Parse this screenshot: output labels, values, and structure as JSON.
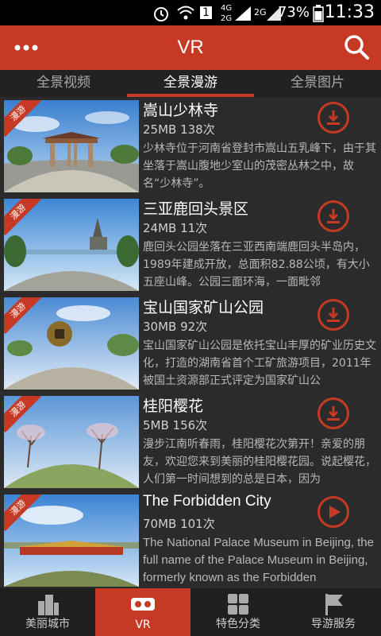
{
  "status_bar": {
    "battery": "73%",
    "time": "11:33"
  },
  "app_bar": {
    "title": "VR"
  },
  "tabs": [
    {
      "label": "全景视频"
    },
    {
      "label": "全景漫游"
    },
    {
      "label": "全景图片"
    }
  ],
  "badge_label": "漫游",
  "items": [
    {
      "title": "嵩山少林寺",
      "meta": "25MB  138次",
      "desc": "少林寺位于河南省登封市嵩山五乳峰下，由于其坐落于嵩山腹地少室山的茂密丛林之中，故名“少林寺”。",
      "action": "download"
    },
    {
      "title": "三亚鹿回头景区",
      "meta": "24MB  11次",
      "desc": "鹿回头公园坐落在三亚西南端鹿回头半岛内，1989年建成开放，总面积82.88公顷，有大小五座山峰。公园三面环海，一面毗邻",
      "action": "download"
    },
    {
      "title": "宝山国家矿山公园",
      "meta": "30MB  92次",
      "desc": "宝山国家矿山公园是依托宝山丰厚的矿业历史文化，打造的湖南省首个工矿旅游项目，2011年被国土资源部正式评定为国家矿山公",
      "action": "download"
    },
    {
      "title": "桂阳樱花",
      "meta": "5MB  156次",
      "desc": "漫步江南听春雨，桂阳樱花次第开！亲爱的朋友，欢迎您来到美丽的桂阳樱花园。说起樱花，人们第一时间想到的总是日本，因为",
      "action": "download"
    },
    {
      "title": "The Forbidden City",
      "meta": "70MB  101次",
      "desc": "The National Palace Museum in Beijing, the full name of the Palace Museum in Beijing, formerly known as the Forbidden",
      "action": "play"
    }
  ],
  "bottom_nav": [
    {
      "label": "美丽城市"
    },
    {
      "label": "VR"
    },
    {
      "label": "特色分类"
    },
    {
      "label": "导游服务"
    }
  ],
  "colors": {
    "accent": "#c63a25",
    "background": "#2b2b2b"
  }
}
